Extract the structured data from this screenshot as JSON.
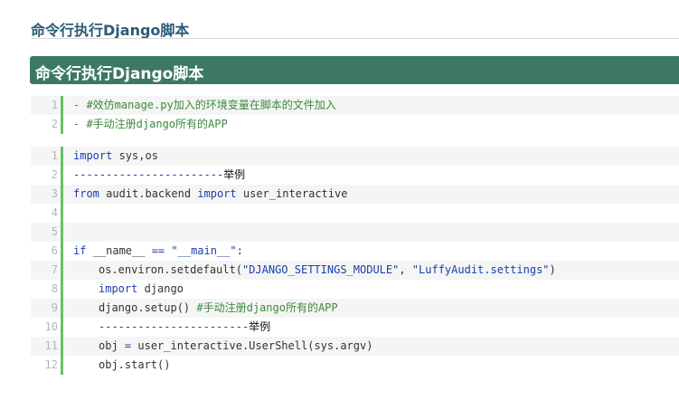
{
  "page": {
    "title": "命令行执行Django脚本",
    "section_heading": "命令行执行Django脚本"
  },
  "block1": {
    "lines": [
      {
        "num": "1",
        "dash": "- ",
        "comment": "#效仿manage.py加入的环境变量在脚本的文件加入"
      },
      {
        "num": "2",
        "dash": "- ",
        "comment": "#手动注册django所有的APP"
      }
    ]
  },
  "block2": {
    "line_numbers": [
      "1",
      "2",
      "3",
      "4",
      "5",
      "6",
      "7",
      "8",
      "9",
      "10",
      "11",
      "12"
    ],
    "l1": {
      "kw": "import",
      "rest": " sys,os"
    },
    "l2": {
      "dashes": "-----------------------",
      "cjk": "举例"
    },
    "l3": {
      "kw1": "from",
      "mid": " audit.backend ",
      "kw2": "import",
      "rest": " user_interactive"
    },
    "l6": {
      "kw": "if",
      "mid": " __name__ ",
      "op": "==",
      "sp": " ",
      "str": "\"__main__\"",
      "end": ":"
    },
    "l7": {
      "pre": "os.environ.setdefault(",
      "str1": "\"DJANGO_SETTINGS_MODULE\"",
      "comma": ", ",
      "str2": "\"LuffyAudit.settings\"",
      "end": ")"
    },
    "l8": {
      "kw": "import",
      "rest": " django"
    },
    "l9": {
      "pre": "django.setup() ",
      "comment": "#手动注册django所有的APP"
    },
    "l10": {
      "dashes": "-----------------------",
      "cjk": "举例"
    },
    "l11": {
      "pre": "obj ",
      "op": "=",
      "rest": " user_interactive.UserShell(sys.argv)"
    },
    "l12": {
      "pre": "obj.start()"
    }
  },
  "colors": {
    "title": "#2b5c77",
    "banner": "#3d7866",
    "gutter": "#68c068",
    "keyword": "#1f3cae",
    "comment": "#3a8a3a"
  }
}
